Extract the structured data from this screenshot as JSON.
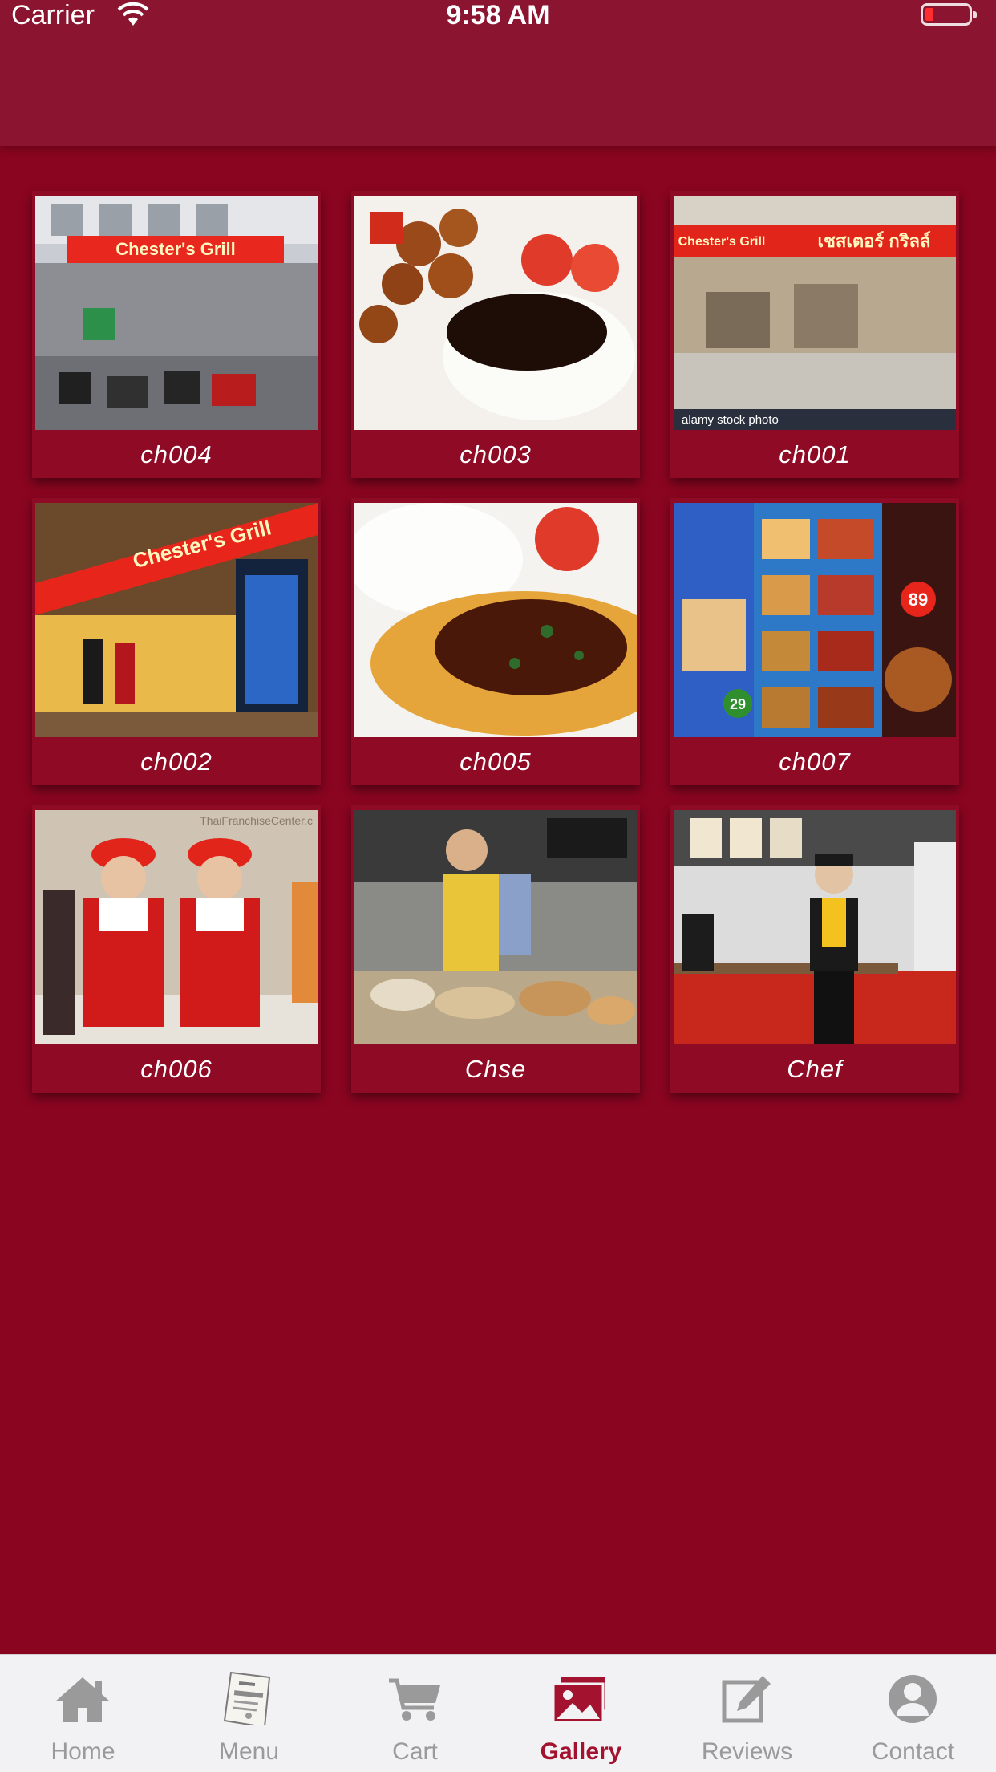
{
  "status_bar": {
    "carrier": "Carrier",
    "time": "9:58 AM"
  },
  "colors": {
    "background": "#8a0520",
    "header": "#8b1530",
    "active_tab": "#a3132f",
    "inactive_tab": "#9a9a9a"
  },
  "gallery": {
    "items": [
      {
        "caption": "ch004"
      },
      {
        "caption": "ch003"
      },
      {
        "caption": "ch001"
      },
      {
        "caption": "ch002"
      },
      {
        "caption": "ch005"
      },
      {
        "caption": "ch007"
      },
      {
        "caption": "ch006"
      },
      {
        "caption": "Chse"
      },
      {
        "caption": "Chef"
      }
    ]
  },
  "photo_text": {
    "sign_chester": "Chester's Grill",
    "sign_thai": "เชสเตอร์ กริลล์",
    "watermark_alamy": "alamy stock photo",
    "price_89": "89",
    "price_29": "29",
    "watermark_franchise": "ThaiFranchiseCenter.c"
  },
  "tab_bar": {
    "tabs": [
      {
        "label": "Home",
        "icon": "home-icon"
      },
      {
        "label": "Menu",
        "icon": "menu-book-icon"
      },
      {
        "label": "Cart",
        "icon": "cart-icon"
      },
      {
        "label": "Gallery",
        "icon": "gallery-icon",
        "active": true
      },
      {
        "label": "Reviews",
        "icon": "reviews-icon"
      },
      {
        "label": "Contact",
        "icon": "contact-icon"
      }
    ]
  }
}
